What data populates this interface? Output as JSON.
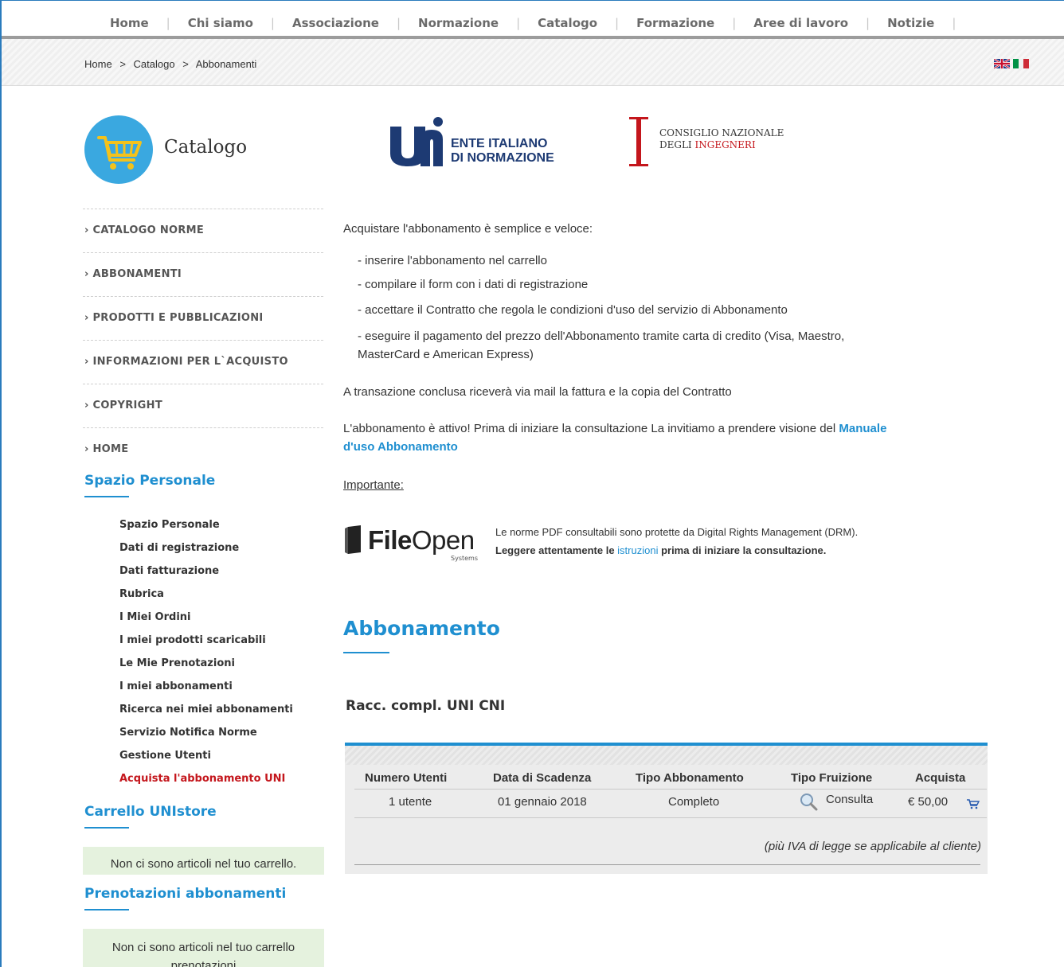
{
  "nav": [
    "Home",
    "Chi siamo",
    "Associazione",
    "Normazione",
    "Catalogo",
    "Formazione",
    "Aree di lavoro",
    "Notizie"
  ],
  "breadcrumb": [
    "Home",
    ">",
    "Catalogo",
    ">",
    "Abbonamenti"
  ],
  "catalog": {
    "title": "Catalogo"
  },
  "logos": {
    "uni_line1": "ENTE ITALIANO",
    "uni_line2": "DI NORMAZIONE",
    "cni_line1": "CONSIGLIO NAZIONALE",
    "cni_line2a": "DEGLI ",
    "cni_line2b": "INGEGNERI"
  },
  "leftmenu": [
    "CATALOGO NORME",
    "ABBONAMENTI",
    "PRODOTTI E PUBBLICAZIONI",
    "INFORMAZIONI PER L`ACQUISTO",
    "COPYRIGHT",
    "HOME"
  ],
  "spazio": {
    "title": "Spazio Personale",
    "items": [
      "Spazio Personale",
      "Dati di registrazione",
      "Dati fatturazione",
      "Rubrica",
      "I Miei Ordini",
      "I miei prodotti scaricabili",
      "Le Mie Prenotazioni",
      "I miei abbonamenti",
      "Ricerca nei miei abbonamenti",
      "Servizio Notifica Norme",
      "Gestione Utenti",
      "Acquista l'abbonamento UNI"
    ]
  },
  "cart": {
    "title": "Carrello UNIstore",
    "empty": "Non ci sono articoli nel tuo carrello."
  },
  "prenotazioni": {
    "title": "Prenotazioni abbonamenti",
    "empty_line1": "Non ci sono articoli nel tuo carrello",
    "empty_line2": "prenotazioni"
  },
  "content": {
    "intro": "Acquistare l'abbonamento è semplice e veloce:",
    "step1": "-   inserire l'abbonamento nel carrello",
    "step2": "-   compilare il form con i dati di registrazione",
    "step3": "-   accettare il Contratto che regola le condizioni d'uso del servizio di Abbonamento",
    "step4a": "-   eseguire il pagamento del prezzo dell'Abbonamento tramite carta di credito (Visa, Maestro,",
    "step4b": "MasterCard e American Express)",
    "transazione": "A transazione conclusa riceverà via mail la fattura e la copia del Contratto",
    "attivo": "L'abbonamento è attivo! Prima di iniziare la consultazione La invitiamo a prendere visione del ",
    "manuale1": "Manuale",
    "manuale2": "d'uso Abbonamento",
    "importante": "Importante:"
  },
  "fileopen": {
    "brand_bold": "File",
    "brand_light": "Open",
    "systems": "Systems",
    "line1": "Le norme PDF consultabili sono protette da Digital Rights Management (DRM).",
    "line2a": "Leggere attentamente le ",
    "line2_link": "istruzioni",
    "line2b": " prima di iniziare la consultazione."
  },
  "abbonamento": {
    "title": "Abbonamento",
    "product": "Racc. compl. UNI CNI",
    "headers": [
      "Numero Utenti",
      "Data di Scadenza",
      "Tipo Abbonamento",
      "Tipo Fruizione",
      "Acquista"
    ],
    "row": {
      "utenti": "1 utente",
      "scadenza": "01 gennaio 2018",
      "tipo": "Completo",
      "fruizione": "Consulta",
      "prezzo": "€ 50,00"
    },
    "iva_note": "(più IVA di legge se applicabile al cliente)"
  },
  "colors": {
    "accent": "#1f8fd0",
    "red": "#c4161c",
    "cartbg": "#e5f2de"
  }
}
